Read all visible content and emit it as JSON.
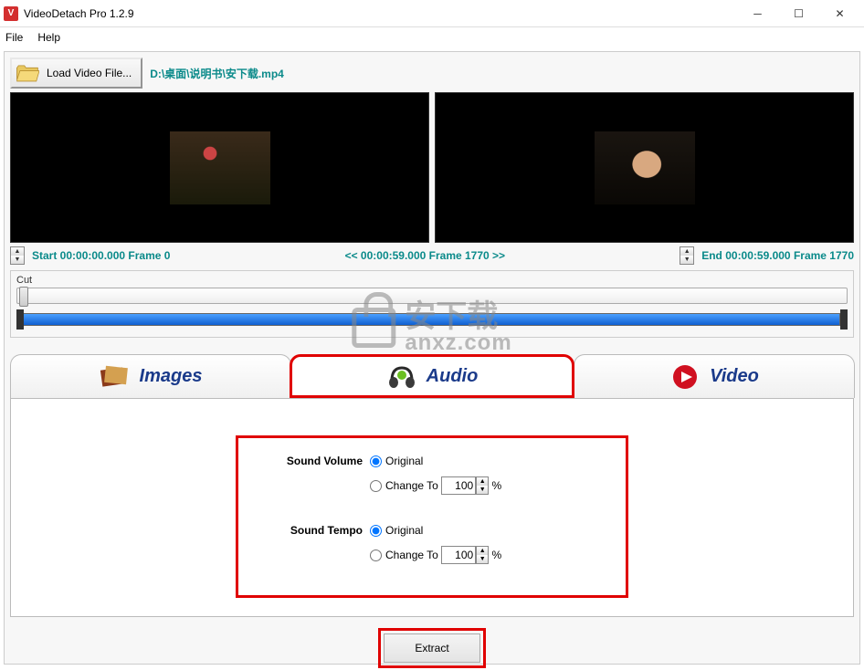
{
  "titlebar": {
    "app_icon_letter": "V",
    "title": "VideoDetach Pro 1.2.9"
  },
  "menubar": {
    "file": "File",
    "help": "Help"
  },
  "toolbar": {
    "load_label": "Load Video File...",
    "file_path": "D:\\桌面\\说明书\\安下载.mp4"
  },
  "preview": {
    "start_label": "Start 00:00:00.000  Frame 0",
    "mid_label": "<< 00:00:59.000  Frame 1770 >>",
    "end_label": "End 00:00:59.000  Frame 1770"
  },
  "cut": {
    "label": "Cut"
  },
  "tabs": {
    "images": "Images",
    "audio": "Audio",
    "video": "Video"
  },
  "audio_panel": {
    "volume_label": "Sound Volume",
    "tempo_label": "Sound Tempo",
    "original": "Original",
    "change_to": "Change To",
    "volume_value": "100",
    "tempo_value": "100",
    "percent": "%"
  },
  "extract": {
    "label": "Extract"
  },
  "watermark": {
    "text1": "安下载",
    "text2": "anxz.com"
  }
}
